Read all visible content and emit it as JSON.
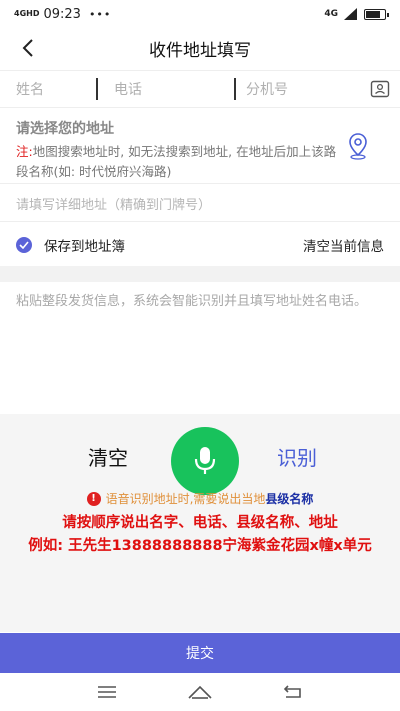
{
  "status_bar": {
    "network": "4GHD",
    "time": "09:23",
    "left_icons": "•••",
    "network_right": "4G",
    "battery_level": 0.85
  },
  "header": {
    "title": "收件地址填写"
  },
  "contact": {
    "name_placeholder": "姓名",
    "phone_placeholder": "电话",
    "ext_placeholder": "分机号"
  },
  "address": {
    "select_title": "请选择您的地址",
    "note_prefix": "注:",
    "note_text": "地图搜索地址时, 如无法搜索到地址, 在地址后加上该路段名称(如: 时代悦府兴海路)",
    "detail_placeholder": "请填写详细地址（精确到门牌号）"
  },
  "save": {
    "save_label": "保存到地址簿",
    "clear_label": "清空当前信息"
  },
  "paste": {
    "placeholder": "粘贴整段发货信息，系统会智能识别并且填写地址姓名电话。"
  },
  "voice": {
    "clear_label": "清空",
    "recognize_label": "识别",
    "tip_text": "语音识别地址时,需要说出当地",
    "tip_bold": "县级名称",
    "instruction_1": "请按顺序说出名字、电话、县级名称、地址",
    "instruction_2": "例如: 王先生13888888888宁海紫金花园x幢x单元"
  },
  "submit": {
    "label": "提交"
  },
  "colors": {
    "primary": "#5b63d8",
    "mic_green": "#18c25c",
    "alert_red": "#e01010",
    "tip_orange": "#e0903a"
  },
  "icons": {
    "back": "chevron-left-icon",
    "contact_book": "contact-book-icon",
    "location": "location-pin-icon",
    "check": "check-circle-icon",
    "mic": "microphone-icon",
    "warning": "warning-icon"
  }
}
